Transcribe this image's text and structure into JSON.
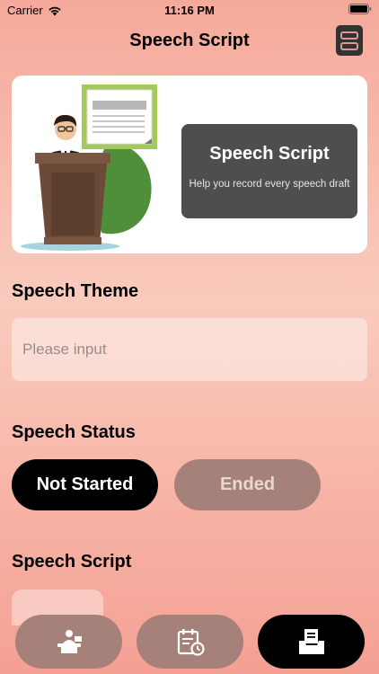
{
  "status_bar": {
    "carrier": "Carrier",
    "time": "11:16 PM"
  },
  "nav": {
    "title": "Speech Script"
  },
  "banner": {
    "title": "Speech Script",
    "subtitle": "Help you record every speech draft"
  },
  "theme": {
    "label": "Speech Theme",
    "placeholder": "Please input"
  },
  "status": {
    "label": "Speech Status",
    "options": [
      "Not Started",
      "Ended"
    ],
    "selected": "Not Started"
  },
  "script": {
    "label": "Speech Script"
  },
  "tabbar": {
    "tabs": [
      "speaker-icon",
      "calendar-clock-icon",
      "inbox-document-icon"
    ],
    "active": 2
  },
  "colors": {
    "accent": "#000000",
    "muted": "#a6817a",
    "card": "#4e4e4e"
  }
}
